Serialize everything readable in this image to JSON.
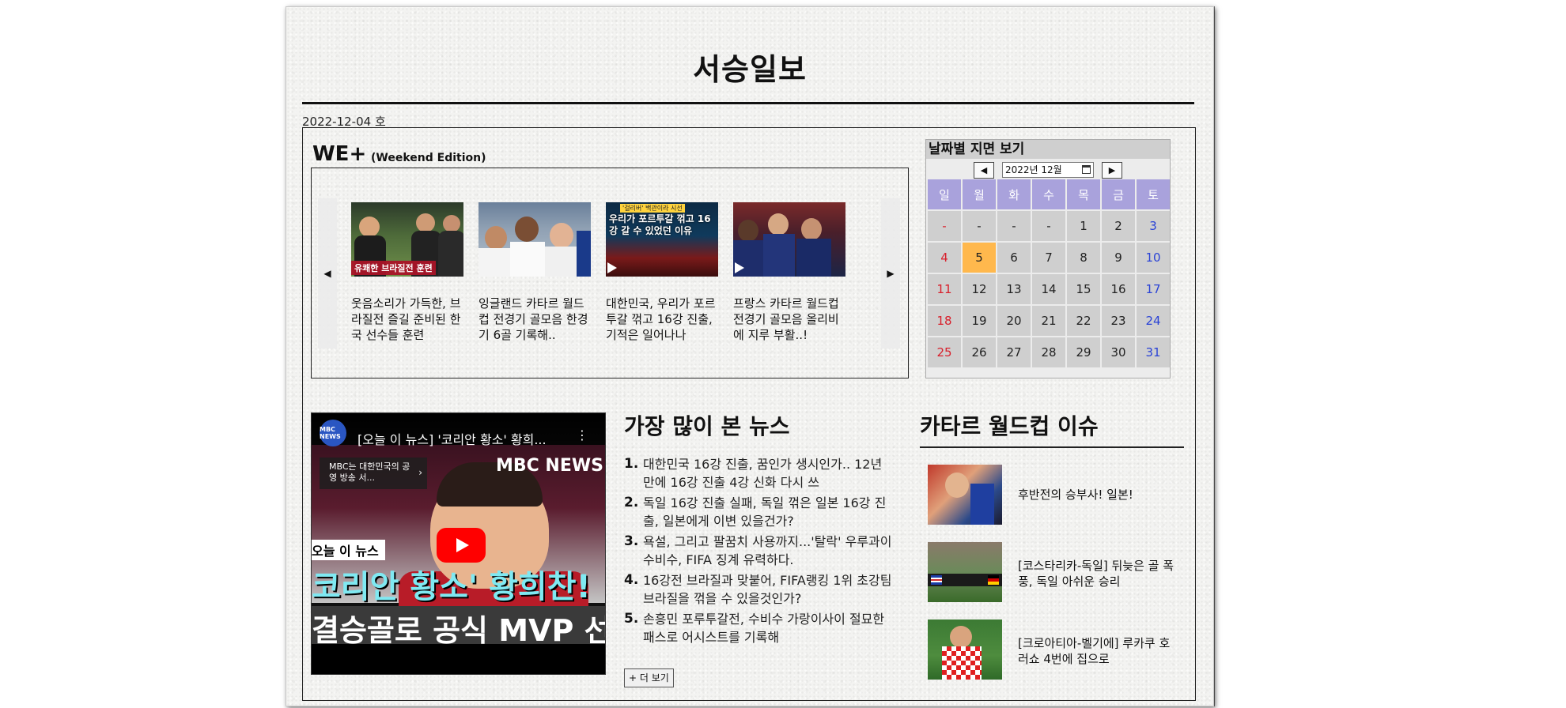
{
  "masthead": {
    "title": "서승일보",
    "issue": "2022-12-04 호"
  },
  "weplus": {
    "title": "WE+",
    "subtitle": "(Weekend Edition)",
    "prev": "◀",
    "next": "▶",
    "cards": [
      {
        "text": "웃음소리가 가득한, 브라질전 즐길 준비된 한국 선수들 훈련",
        "caption": "유쾌한 브라질전 훈련"
      },
      {
        "text": "잉글랜드 카타르 월드컵 전경기 골모음 한경기 6골 기록해.."
      },
      {
        "text": "대한민국, 우리가 포르투갈 꺾고 16강 진출, 기적은 일어나나",
        "overlay_top": "'걸리버' 백관이라 시선",
        "overlay": "우리가 포르투갈 꺾고 16강 갈 수 있었던 이유"
      },
      {
        "text": "프랑스 카타르 월드컵 전경기 골모음 올리비에 지루 부활..!"
      }
    ]
  },
  "calendar": {
    "title": "날짜별 지면 보기",
    "month": "2022년 12월",
    "prev": "◀",
    "next": "▶",
    "weekdays": [
      "일",
      "월",
      "화",
      "수",
      "목",
      "금",
      "토"
    ],
    "days": [
      "-",
      "-",
      "-",
      "-",
      "1",
      "2",
      "3",
      "4",
      "5",
      "6",
      "7",
      "8",
      "9",
      "10",
      "11",
      "12",
      "13",
      "14",
      "15",
      "16",
      "17",
      "18",
      "19",
      "20",
      "21",
      "22",
      "23",
      "24",
      "25",
      "26",
      "27",
      "28",
      "29",
      "30",
      "31"
    ],
    "selected": "5",
    "colors": {
      "header": "#a9a2dc",
      "cell": "#cfcfcf",
      "selected": "#ffb84d",
      "sunday": "#d8202c",
      "saturday": "#2a43d6"
    }
  },
  "video": {
    "channel": "MBC NEWS",
    "title": "[오늘 이 뉴스] '코리안 황소' 황희...",
    "menu": "⋮",
    "popup": "MBC는 대한민국의 공영 방송 서...",
    "popup_arrow": "›",
    "badge": "오늘 이 뉴스",
    "headline_1": "코리안 황소' 황희찬!",
    "headline_2": "결승골로 공식 MVP 선정",
    "logo_text": "MBC NEWS"
  },
  "most_viewed": {
    "title": "가장 많이 본 뉴스",
    "items": [
      {
        "num": "1.",
        "text": "대한민국 16강 진출, 꿈인가 생시인가.. 12년만에 16강 진출 4강 신화 다시 쓰"
      },
      {
        "num": "2.",
        "text": "독일 16강 진출 실패, 독일 꺾은 일본 16강 진출, 일본에게 이변 있을건가?"
      },
      {
        "num": "3.",
        "text": "욕설, 그리고 팔꿈치 사용까지...'탈락' 우루과이 수비수, FIFA 징계 유력하다."
      },
      {
        "num": "4.",
        "text": "16강전 브라질과 맞붙어, FIFA랭킹 1위 초강팀 브라질을 꺾을 수 있을것인가?"
      },
      {
        "num": "5.",
        "text": "손흥민 포루투갈전, 수비수 가랑이사이 절묘한 패스로 어시스트를 기록해"
      }
    ],
    "more_label": "+ 더 보기"
  },
  "qatar_issue": {
    "title": "카타르 월드컵 이슈",
    "items": [
      {
        "text": "후반전의 승부사! 일본!"
      },
      {
        "text": "[코스타리카-독일] 뒤늦은 골 폭풍, 독일 아쉬운 승리"
      },
      {
        "text": "[크로아티아-벨기에] 루카쿠 호러쇼 4번에 집으로"
      }
    ]
  }
}
